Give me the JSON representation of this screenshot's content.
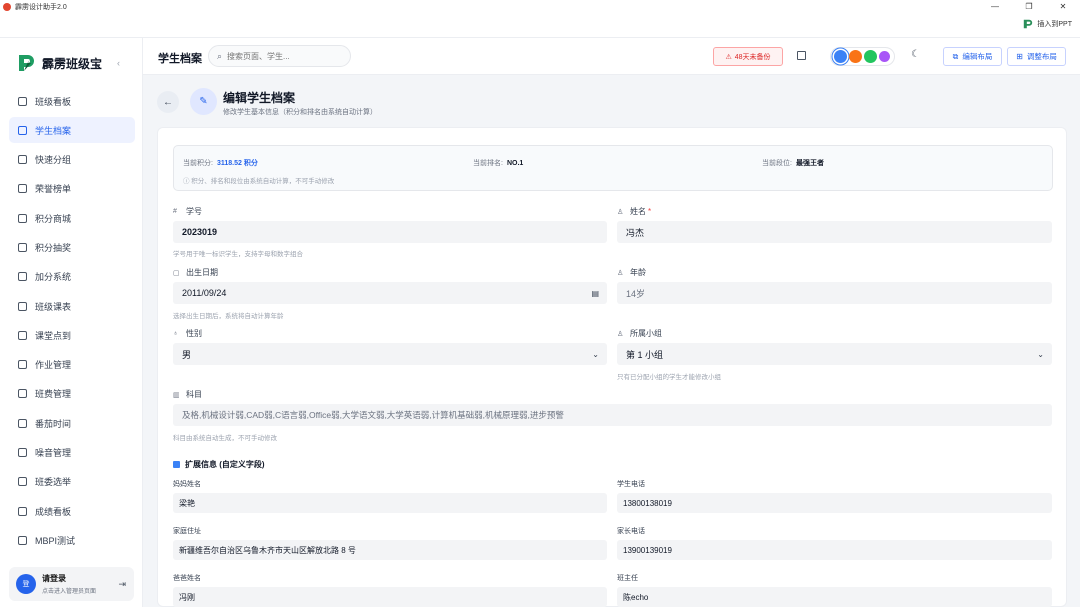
{
  "window": {
    "title": "霹雳设计助手2.0",
    "min": "—",
    "restore": "❐",
    "close": "✕"
  },
  "ppt": {
    "label": "插入到PPT"
  },
  "sidebar": {
    "brand": "霹雳班级宝",
    "collapse": "‹",
    "items": [
      {
        "label": "班级看板"
      },
      {
        "label": "学生档案"
      },
      {
        "label": "快速分组"
      },
      {
        "label": "荣誉榜单"
      },
      {
        "label": "积分商城"
      },
      {
        "label": "积分抽奖"
      },
      {
        "label": "加分系统"
      },
      {
        "label": "班级课表"
      },
      {
        "label": "课堂点到"
      },
      {
        "label": "作业管理"
      },
      {
        "label": "班费管理"
      },
      {
        "label": "番茄时间"
      },
      {
        "label": "噪音管理"
      },
      {
        "label": "班委选举"
      },
      {
        "label": "成绩看板"
      },
      {
        "label": "MBPI测试"
      }
    ],
    "login": {
      "avatar": "登",
      "title": "请登录",
      "subtitle": "点击进入管理员页面"
    }
  },
  "header": {
    "title": "学生档案",
    "search_placeholder": "搜索页面、学生...",
    "backup": "48天未备份",
    "colors": [
      "#3b82f6",
      "#f97316",
      "#22c55e",
      "#a855f7"
    ],
    "edit_layout": "编辑布局",
    "adjust_layout": "调整布局"
  },
  "form": {
    "title": "编辑学生档案",
    "subtitle": "修改学生基本信息（积分和排名由系统自动计算）",
    "info": {
      "score_label": "当前积分:",
      "score_value": "3118.52 积分",
      "rank_label": "当前排名:",
      "rank_value": "NO.1",
      "tier_label": "当前段位:",
      "tier_value": "最强王者",
      "note": "ⓘ 积分、排名和段位由系统自动计算，不可手动修改"
    },
    "student_id": {
      "label": "学号",
      "value": "2023019",
      "hint": "学号用于唯一标识学生，支持字母和数字组合"
    },
    "name": {
      "label": "姓名",
      "required": "*",
      "value": "冯杰"
    },
    "birth": {
      "label": "出生日期",
      "value": "2011/09/24",
      "hint": "选择出生日期后，系统将自动计算年龄"
    },
    "age": {
      "label": "年龄",
      "value": "14岁"
    },
    "gender": {
      "label": "性别",
      "value": "男"
    },
    "group": {
      "label": "所属小组",
      "value": "第 1 小组",
      "hint": "只有已分配小组的学生才能修改小组"
    },
    "subjects": {
      "label": "科目",
      "value": "及格,机械设计弱,CAD弱,C语言弱,Office弱,大学语文弱,大学英语弱,计算机基础弱,机械原理弱,进步预警",
      "hint": "科目由系统自动生成，不可手动修改"
    },
    "ext": {
      "title": "扩展信息 (自定义字段)",
      "mother_name": {
        "label": "妈妈姓名",
        "value": "梁艳"
      },
      "student_phone": {
        "label": "学生电话",
        "value": "13800138019"
      },
      "address": {
        "label": "家庭住址",
        "value": "新疆维吾尔自治区乌鲁木齐市天山区解放北路 8 号"
      },
      "parent_phone": {
        "label": "家长电话",
        "value": "13900139019"
      },
      "father_name": {
        "label": "爸爸姓名",
        "value": "冯刚"
      },
      "teacher": {
        "label": "班主任",
        "value": "陈echo"
      }
    }
  }
}
